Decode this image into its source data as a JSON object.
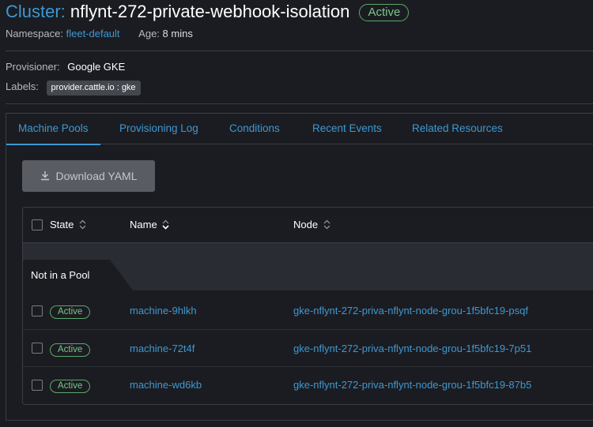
{
  "header": {
    "title_prefix": "Cluster:",
    "cluster_name": "nflynt-272-private-webhook-isolation",
    "state": "Active"
  },
  "meta": {
    "namespace_label": "Namespace:",
    "namespace_value": "fleet-default",
    "age_label": "Age:",
    "age_value": "8 mins"
  },
  "details": {
    "provisioner_label": "Provisioner:",
    "provisioner_value": "Google GKE",
    "labels_label": "Labels:",
    "label_chip": "provider.cattle.io : gke"
  },
  "tabs": [
    {
      "label": "Machine Pools",
      "active": true
    },
    {
      "label": "Provisioning Log",
      "active": false
    },
    {
      "label": "Conditions",
      "active": false
    },
    {
      "label": "Recent Events",
      "active": false
    },
    {
      "label": "Related Resources",
      "active": false
    }
  ],
  "actions": {
    "download_yaml": "Download YAML"
  },
  "table": {
    "columns": {
      "state": "State",
      "name": "Name",
      "node": "Node"
    },
    "group_label": "Not in a Pool",
    "rows": [
      {
        "state": "Active",
        "name": "machine-9hlkh",
        "node": "gke-nflynt-272-priva-nflynt-node-grou-1f5bfc19-psqf"
      },
      {
        "state": "Active",
        "name": "machine-72t4f",
        "node": "gke-nflynt-272-priva-nflynt-node-grou-1f5bfc19-7p51"
      },
      {
        "state": "Active",
        "name": "machine-wd6kb",
        "node": "gke-nflynt-272-priva-nflynt-node-grou-1f5bfc19-87b5"
      }
    ]
  },
  "colors": {
    "accent": "#3d98d3",
    "active": "#5aa96b",
    "background": "#1b1c21"
  },
  "icons": [
    "download-icon",
    "sort-icon",
    "sort-down-icon",
    "checkbox"
  ]
}
